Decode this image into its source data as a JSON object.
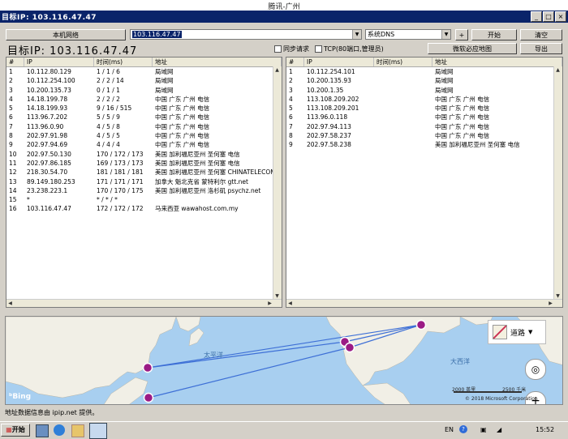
{
  "window": {
    "title": "腾讯-广州",
    "menubar_title": "目标IP: 103.116.47.47",
    "controls": {
      "minimize": "_",
      "maximize": "□",
      "close": "×"
    }
  },
  "toolbar": {
    "local_network_btn": "本机网络",
    "target_input": "103.116.47.47",
    "dns_select": "系统DNS",
    "add_btn": "+",
    "start_btn": "开始",
    "clear_btn": "清空",
    "ms_map_btn": "微软必应地图",
    "export_btn": "导出",
    "big_target_label": "目标IP: 103.116.47.47",
    "sync_request_label": "同步请求",
    "tcp_label": "TCP(80端口,管理员)"
  },
  "left_table": {
    "headers": [
      "#",
      "IP",
      "时间(ms)",
      "地址"
    ],
    "rows": [
      [
        "1",
        "10.112.80.129",
        "1 / 1 / 6",
        "局域网"
      ],
      [
        "2",
        "10.112.254.100",
        "2 / 2 / 14",
        "局域网"
      ],
      [
        "3",
        "10.200.135.73",
        "0 / 1 / 1",
        "局域网"
      ],
      [
        "4",
        "14.18.199.78",
        "2 / 2 / 2",
        "中国 广东 广州 电信"
      ],
      [
        "5",
        "14.18.199.93",
        "9 / 16 / 515",
        "中国 广东 广州 电信"
      ],
      [
        "6",
        "113.96.7.202",
        "5 / 5 / 9",
        "中国 广东 广州 电信"
      ],
      [
        "7",
        "113.96.0.90",
        "4 / 5 / 8",
        "中国 广东 广州 电信"
      ],
      [
        "8",
        "202.97.91.98",
        "4 / 5 / 5",
        "中国 广东 广州 电信"
      ],
      [
        "9",
        "202.97.94.69",
        "4 / 4 / 4",
        "中国 广东 广州 电信"
      ],
      [
        "10",
        "202.97.50.130",
        "170 / 172 / 173",
        "美国 加利福尼亚州 圣何塞 电信"
      ],
      [
        "11",
        "202.97.86.185",
        "169 / 173 / 173",
        "美国 加利福尼亚州 圣何塞 电信"
      ],
      [
        "12",
        "218.30.54.70",
        "181 / 181 / 181",
        "美国 加利福尼亚州 圣何塞 CHINATELECOM"
      ],
      [
        "13",
        "89.149.180.253",
        "171 / 171 / 171",
        "加拿大 魁北克省 蒙特利尔 gtt.net"
      ],
      [
        "14",
        "23.238.223.1",
        "170 / 170 / 175",
        "美国 加利福尼亚州 洛杉矶 psychz.net"
      ],
      [
        "15",
        "*",
        "* / * / *",
        ""
      ],
      [
        "16",
        "103.116.47.47",
        "172 / 172 / 172",
        "马来西亚 wawahost.com.my"
      ]
    ]
  },
  "right_table": {
    "headers": [
      "#",
      "IP",
      "时间(ms)",
      "地址"
    ],
    "rows": [
      [
        "1",
        "10.112.254.101",
        "",
        "局域网"
      ],
      [
        "2",
        "10.200.135.93",
        "",
        "局域网"
      ],
      [
        "3",
        "10.200.1.35",
        "",
        "局域网"
      ],
      [
        "4",
        "113.108.209.202",
        "",
        "中国 广东 广州 电信"
      ],
      [
        "5",
        "113.108.209.201",
        "",
        "中国 广东 广州 电信"
      ],
      [
        "6",
        "113.96.0.118",
        "",
        "中国 广东 广州 电信"
      ],
      [
        "7",
        "202.97.94.113",
        "",
        "中国 广东 广州 电信"
      ],
      [
        "8",
        "202.97.58.237",
        "",
        "中国 广东 广州 电信"
      ],
      [
        "9",
        "202.97.58.238",
        "",
        "美国 加利福尼亚州 圣何塞 电信"
      ]
    ]
  },
  "map": {
    "pacific_label": "太平洋",
    "atlantic_label": "大西洋",
    "road_label": "道路",
    "bing_label": "Bing",
    "scale_label": "2000 英里",
    "scale_label2": "2500 千米",
    "copyright": "© 2018 Microsoft Corporation",
    "plus": "+",
    "minus": "−"
  },
  "status": {
    "text": "地址数据信息由 ipip.net 提供。"
  },
  "taskbar": {
    "start_label": "开始",
    "lang": "EN",
    "time": "15:52"
  }
}
